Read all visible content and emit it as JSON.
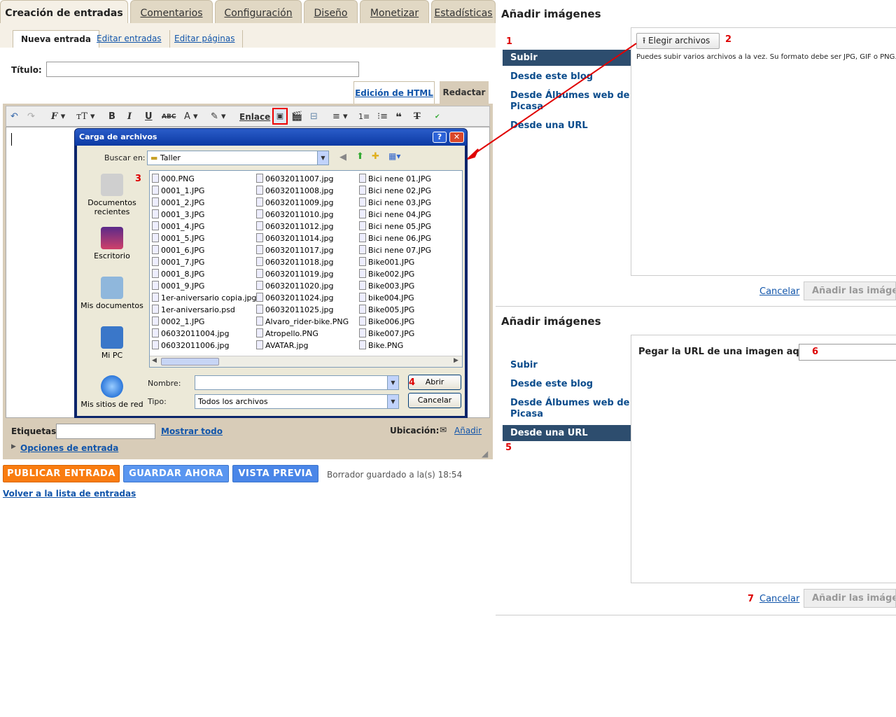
{
  "tabs": [
    "Creación de entradas",
    "Comentarios",
    "Configuración",
    "Diseño",
    "Monetizar",
    "Estadísticas"
  ],
  "subtabs": [
    "Nueva entrada",
    "Editar entradas",
    "Editar páginas"
  ],
  "post": {
    "title_label": "Título:",
    "title_value": "",
    "html_tab": "Edición de HTML",
    "compose_tab": "Redactar",
    "link_label": "Enlace"
  },
  "bottom": {
    "labels_label": "Etiquetas:",
    "show_all": "Mostrar todo",
    "location_label": "Ubicación:",
    "add_location": "Añadir",
    "entry_options": "Opciones de entrada",
    "publish": "PUBLICAR ENTRADA",
    "save": "GUARDAR AHORA",
    "preview": "VISTA PREVIA",
    "saved_status": "Borrador guardado a la(s) 18:54",
    "back_link": "Volver a la lista de entradas"
  },
  "dialog": {
    "title": "Carga de archivos",
    "lookin_label": "Buscar en:",
    "lookin_value": "Taller",
    "places": [
      "Documentos recientes",
      "Escritorio",
      "Mis documentos",
      "Mi PC",
      "Mis sitios de red"
    ],
    "files_col1": [
      "000.PNG",
      "0001_1.JPG",
      "0001_2.JPG",
      "0001_3.JPG",
      "0001_4.JPG",
      "0001_5.JPG",
      "0001_6.JPG",
      "0001_7.JPG",
      "0001_8.JPG",
      "0001_9.JPG",
      "1er-aniversario copia.jpg",
      "1er-aniversario.psd",
      "0002_1.JPG",
      "06032011004.jpg",
      "06032011006.jpg"
    ],
    "files_col2": [
      "06032011007.jpg",
      "06032011008.jpg",
      "06032011009.jpg",
      "06032011010.jpg",
      "06032011012.jpg",
      "06032011014.jpg",
      "06032011017.jpg",
      "06032011018.jpg",
      "06032011019.jpg",
      "06032011020.jpg",
      "06032011024.jpg",
      "06032011025.jpg",
      "Alvaro_rider-bike.PNG",
      "Atropello.PNG",
      "AVATAR.jpg"
    ],
    "files_col3": [
      "Bici nene 01.JPG",
      "Bici nene 02.JPG",
      "Bici nene 03.JPG",
      "Bici nene 04.JPG",
      "Bici nene 05.JPG",
      "Bici nene 06.JPG",
      "Bici nene 07.JPG",
      "Bike001.JPG",
      "Bike002.JPG",
      "Bike003.JPG",
      "bike004.JPG",
      "Bike005.JPG",
      "Bike006.JPG",
      "Bike007.JPG",
      "Bike.PNG"
    ],
    "name_label": "Nombre:",
    "name_value": "",
    "type_label": "Tipo:",
    "type_value": "Todos los archivos",
    "open_button": "Abrir",
    "cancel_button": "Cancelar"
  },
  "panel1": {
    "title": "Añadir imágenes",
    "nav": [
      "Subir",
      "Desde este blog",
      "Desde Álbumes web de Picasa",
      "Desde una URL"
    ],
    "choose_files": "Elegir archivos",
    "hint": "Puedes subir varios archivos a la vez. Su formato debe ser JPG, GIF o PNG.",
    "cancel": "Cancelar",
    "add": "Añadir las imágenes"
  },
  "panel2": {
    "title": "Añadir imágenes",
    "nav": [
      "Subir",
      "Desde este blog",
      "Desde Álbumes web de Picasa",
      "Desde una URL"
    ],
    "url_label": "Pegar la URL de una imagen aquí:",
    "url_value": "",
    "cancel": "Cancelar",
    "add": "Añadir las imágenes"
  },
  "steps": [
    "1",
    "2",
    "3",
    "4",
    "5",
    "6",
    "7"
  ],
  "colors": {
    "publish": "#f97c10",
    "save": "#5a96f0",
    "preview": "#4a86e8",
    "nav_selected": "#2d4d6e",
    "annotation": "#dd0000"
  }
}
